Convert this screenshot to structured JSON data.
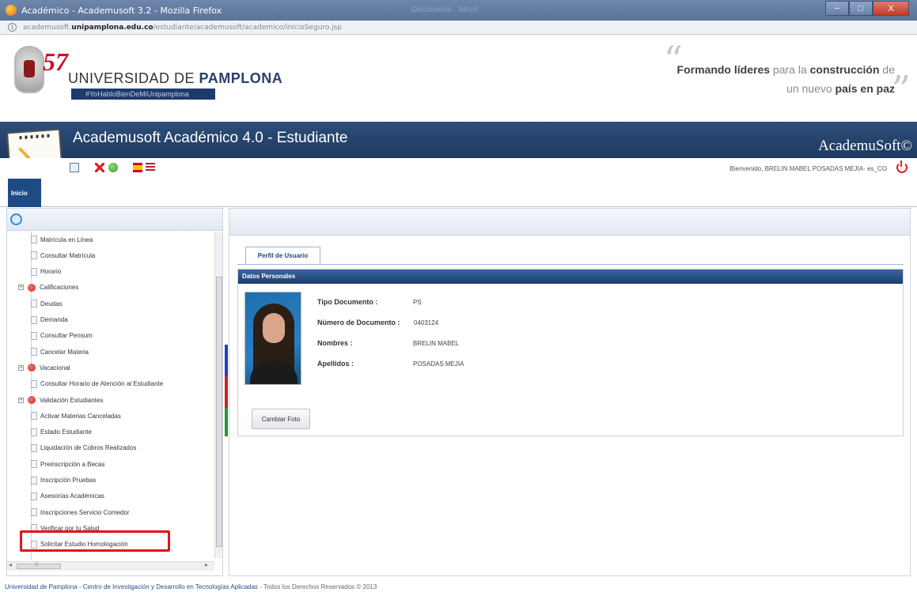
{
  "window": {
    "title": "Académico - Academusoft 3.2 - Mozilla Firefox",
    "faint_title": "Documento · Mozil",
    "minimize": "−",
    "maximize": "□",
    "close": "X"
  },
  "address": {
    "url_prefix": "academusoft.",
    "url_domain": "unipamplona.edu.co",
    "url_path": "/estudiante/academusoft/academico/inicioSeguro.jsp"
  },
  "header": {
    "anniversary": "57",
    "uni_name_prefix": "UNIVERSIDAD DE ",
    "uni_name_bold": "PAMPLONA",
    "hashtag": "#YoHabloBienDeMiUnipamplona",
    "slogan_line1_a": "Formando ",
    "slogan_line1_b": "líderes",
    "slogan_line1_c": " para la ",
    "slogan_line1_d": "construcción",
    "slogan_line1_e": " de",
    "slogan_line2_a": "un nuevo ",
    "slogan_line2_b": "país en paz",
    "quote_open": "“",
    "quote_close": "”"
  },
  "appbar": {
    "title": "Academusoft Académico 4.0 - Estudiante",
    "brand": "AcademuSoft©"
  },
  "toolbar": {
    "welcome": "Bienvenido, BRELIN MABEL POSADAS MEJIA· es_CO"
  },
  "menu": {
    "inicio": "Inicio"
  },
  "tree": {
    "items": [
      {
        "label": "Matrícula en Línea",
        "type": "doc"
      },
      {
        "label": "Consultar Matrícula",
        "type": "doc"
      },
      {
        "label": "Horario",
        "type": "doc"
      },
      {
        "label": "Calificaciones",
        "type": "folder"
      },
      {
        "label": "Deudas",
        "type": "doc"
      },
      {
        "label": "Demanda",
        "type": "doc"
      },
      {
        "label": "Consultar Pensum",
        "type": "doc"
      },
      {
        "label": "Cancelar Materia",
        "type": "doc"
      },
      {
        "label": "Vacacional",
        "type": "folder"
      },
      {
        "label": "Consultar Horario de Atención al Estudiante",
        "type": "doc"
      },
      {
        "label": "Validación Estudiantes",
        "type": "folder"
      },
      {
        "label": "Activar Materias Canceladas",
        "type": "doc"
      },
      {
        "label": "Estado Estudiante",
        "type": "doc"
      },
      {
        "label": "Liquidación de Cobros Realizados",
        "type": "doc"
      },
      {
        "label": "Preinscripción a Becas",
        "type": "doc"
      },
      {
        "label": "Inscripción Pruebas",
        "type": "doc"
      },
      {
        "label": "Asesorías Académicas",
        "type": "doc"
      },
      {
        "label": "Inscripciones Servicio Comedor",
        "type": "doc"
      },
      {
        "label": "Verificar por tu Salud",
        "type": "doc"
      },
      {
        "label": "Solicitar Estudio Homologación",
        "type": "doc"
      }
    ],
    "expander": "+",
    "hscroll_left": "◂",
    "hscroll_right": "▸",
    "hscroll_grip": "|||"
  },
  "profile": {
    "tab": "Perfil de Usuario",
    "section": "Datos Personales",
    "fields": [
      {
        "label": "Tipo Documento :",
        "value": "PS"
      },
      {
        "label": "Número de Documento :",
        "value": "0403124"
      },
      {
        "label": "Nombres :",
        "value": "BRELIN MABEL"
      },
      {
        "label": "Apellidos :",
        "value": "POSADAS MEJIA"
      }
    ],
    "button": "Cambiar Foto"
  },
  "footer": {
    "org": "Universidad de Pamplona - Centro de Investigación y Desarrollo en Tecnologías Aplicadas",
    "rights": " - Todos los Derechos Reservados © 2013"
  },
  "colors": {
    "appbar": "#1e3a62",
    "highlight": "#e0151b",
    "card_head": "#1c3d6e"
  }
}
